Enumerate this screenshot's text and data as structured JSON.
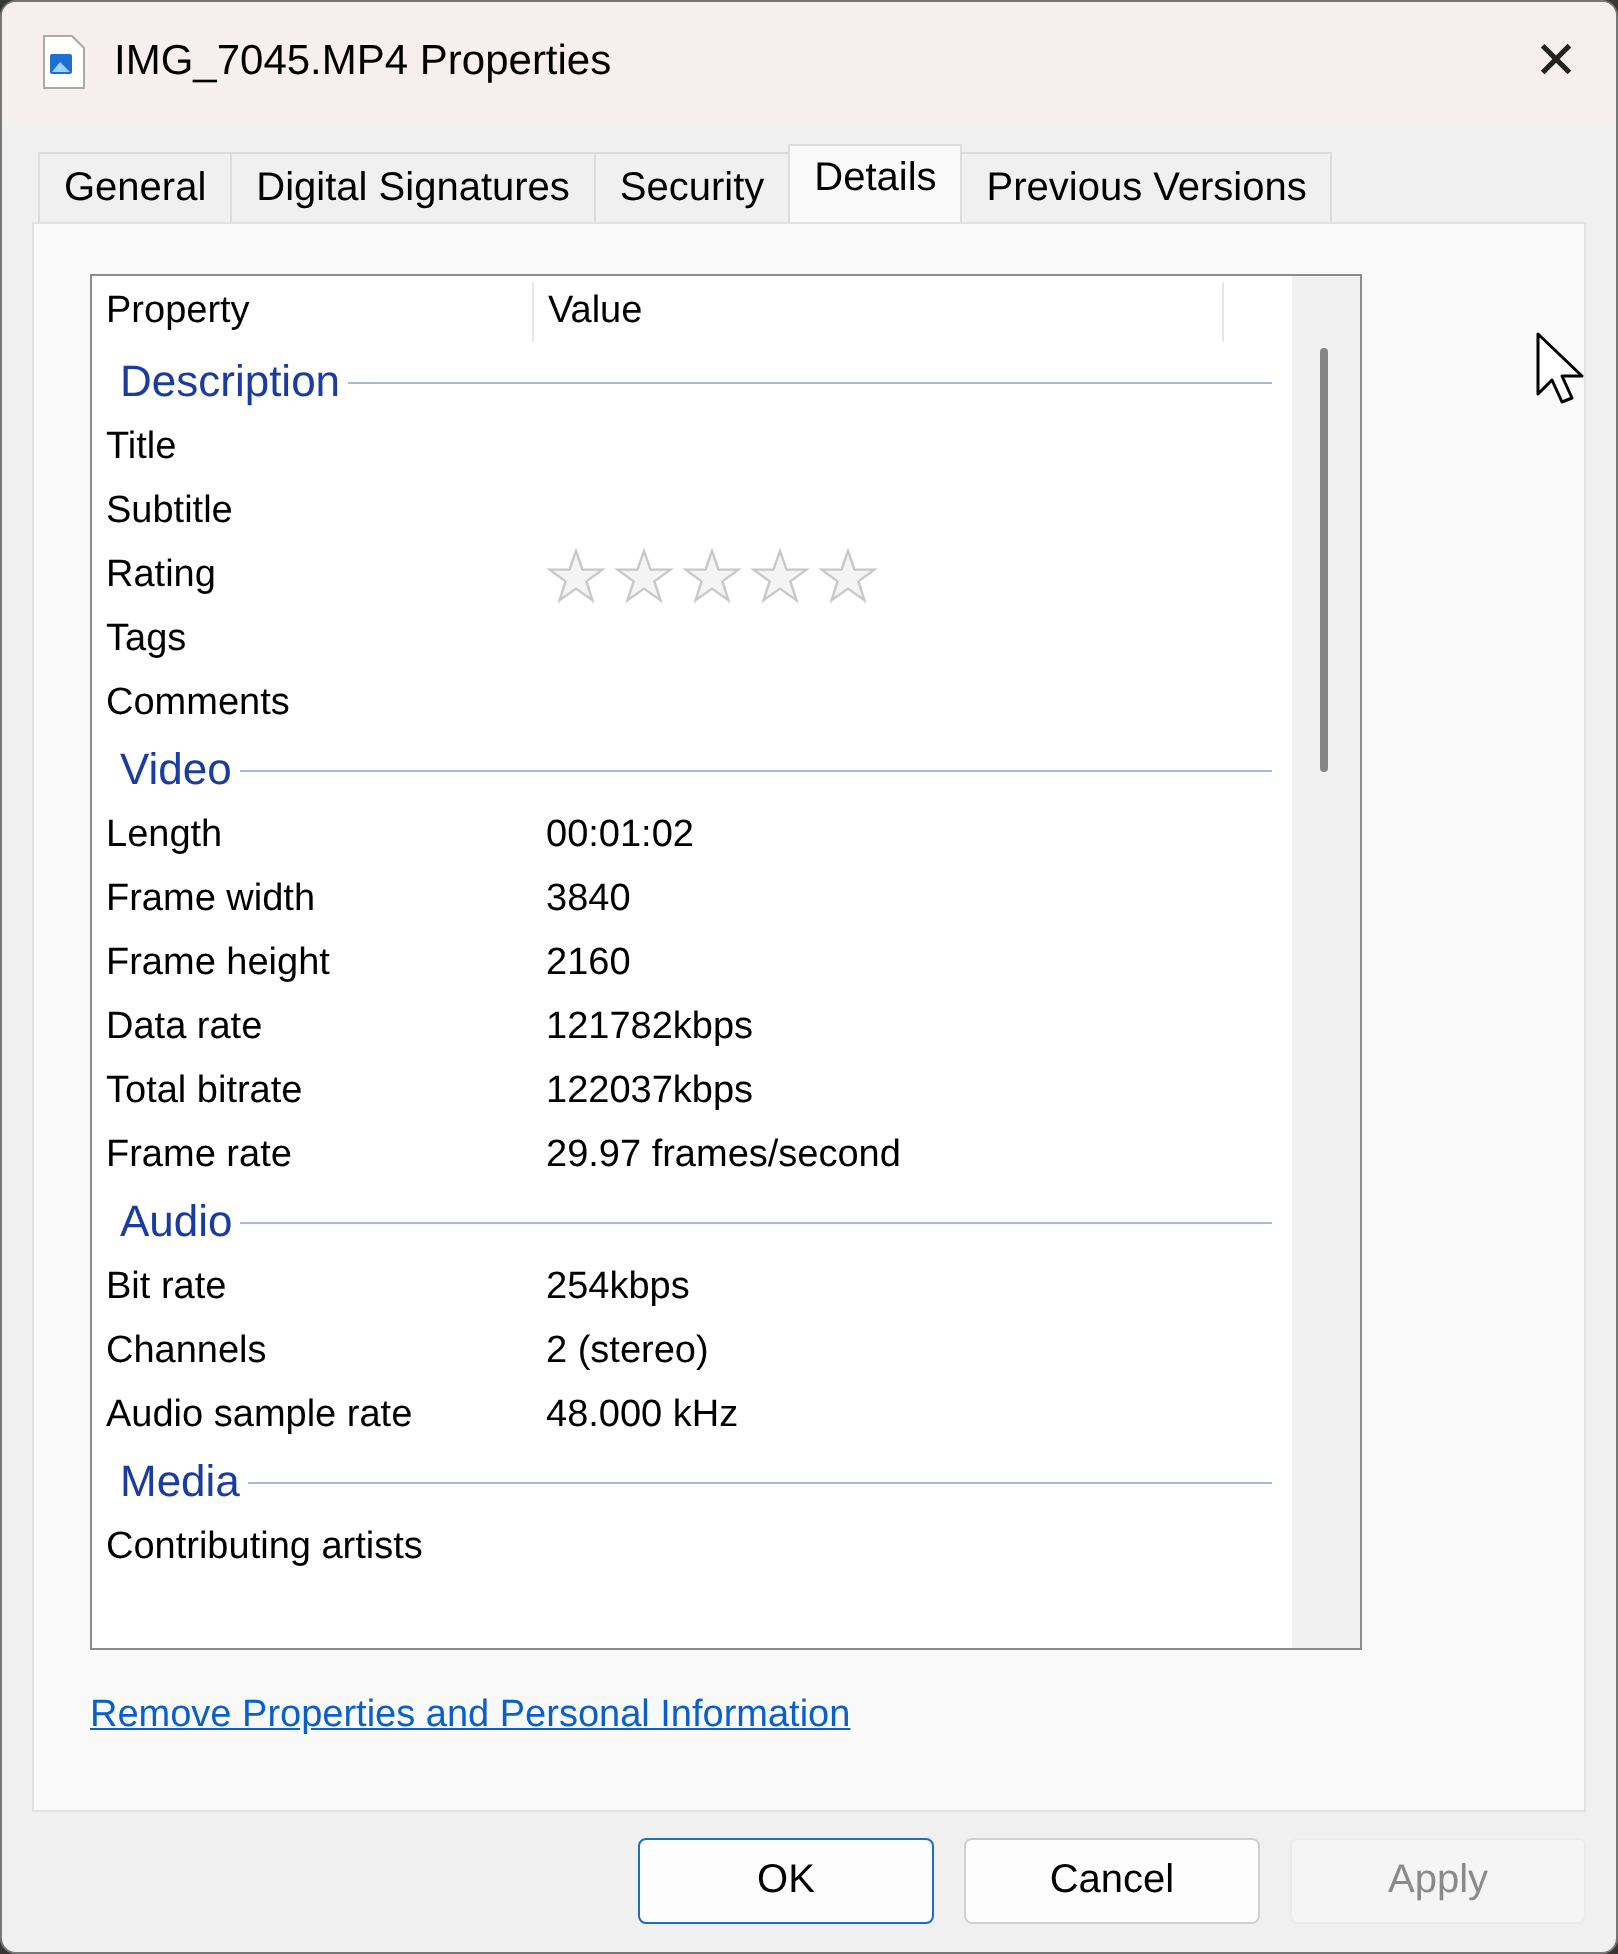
{
  "window": {
    "title": "IMG_7045.MP4 Properties",
    "close": "✕"
  },
  "tabs": [
    {
      "label": "General",
      "selected": false
    },
    {
      "label": "Digital Signatures",
      "selected": false
    },
    {
      "label": "Security",
      "selected": false
    },
    {
      "label": "Details",
      "selected": true
    },
    {
      "label": "Previous Versions",
      "selected": false
    }
  ],
  "table": {
    "columns": [
      "Property",
      "Value"
    ],
    "groups": [
      {
        "title": "Description",
        "rows": [
          {
            "kind": "text",
            "property": "Title"
          },
          {
            "kind": "text",
            "property": "Subtitle"
          },
          {
            "kind": "rating",
            "property": "Rating",
            "stars": 0
          },
          {
            "kind": "text",
            "property": "Tags"
          },
          {
            "kind": "text",
            "property": "Comments"
          }
        ]
      },
      {
        "title": "Video",
        "rows": [
          {
            "kind": "text",
            "property": "Length",
            "value": "00:01:02"
          },
          {
            "kind": "text",
            "property": "Frame width",
            "value": "3840"
          },
          {
            "kind": "text",
            "property": "Frame height",
            "value": "2160"
          },
          {
            "kind": "text",
            "property": "Data rate",
            "value": "121782kbps"
          },
          {
            "kind": "text",
            "property": "Total bitrate",
            "value": "122037kbps"
          },
          {
            "kind": "text",
            "property": "Frame rate",
            "value": "29.97 frames/second"
          }
        ]
      },
      {
        "title": "Audio",
        "rows": [
          {
            "kind": "text",
            "property": "Bit rate",
            "value": "254kbps"
          },
          {
            "kind": "text",
            "property": "Channels",
            "value": "2 (stereo)"
          },
          {
            "kind": "text",
            "property": "Audio sample rate",
            "value": "48.000 kHz"
          }
        ]
      },
      {
        "title": "Media",
        "rows": [
          {
            "kind": "text",
            "property": "Contributing artists"
          }
        ]
      }
    ]
  },
  "link": "Remove Properties and Personal Information",
  "buttons": [
    {
      "label": "OK",
      "disabled": false,
      "default": true
    },
    {
      "label": "Cancel",
      "disabled": false,
      "default": false
    },
    {
      "label": "Apply",
      "disabled": true,
      "default": false
    }
  ]
}
